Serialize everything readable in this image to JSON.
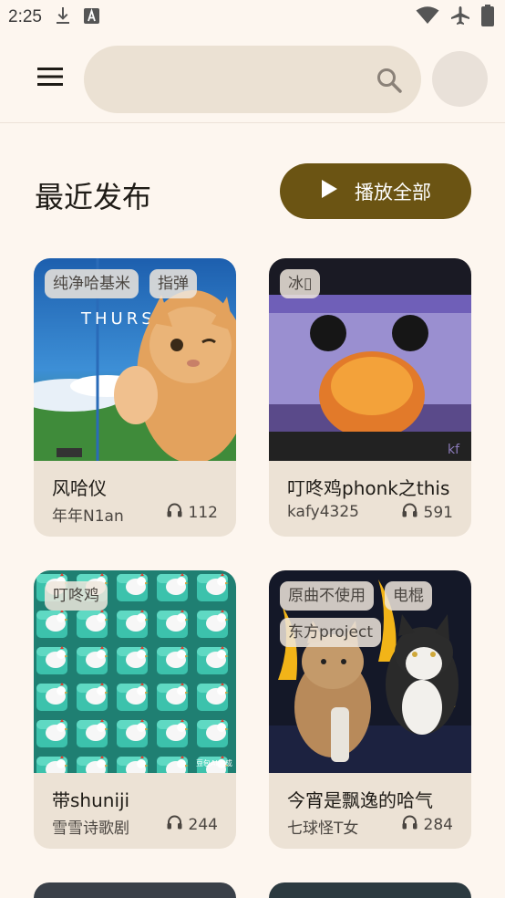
{
  "status_bar": {
    "time": "2:25",
    "left_icons": [
      "download-icon",
      "text-a-icon"
    ],
    "right_icons": [
      "wifi-icon",
      "airplane-icon",
      "battery-icon"
    ]
  },
  "app_bar": {
    "menu_icon": "menu-icon",
    "search": {
      "value": "",
      "placeholder": ""
    },
    "search_icon": "search-icon"
  },
  "section": {
    "title": "最近发布",
    "play_all_label": "播放全部",
    "accent_color": "#6b5413"
  },
  "cards": [
    {
      "title": "风哈仪",
      "author": "年年N1an",
      "plays": "112",
      "tags": [
        "纯净哈基米",
        "指弹"
      ]
    },
    {
      "title": "叮咚鸡phonk之this",
      "author": "kafy4325",
      "plays": "591",
      "tags": [
        "冰▯"
      ]
    },
    {
      "title": "带shuniji",
      "author": "雪雪诗歌剧",
      "plays": "244",
      "tags": [
        "叮咚鸡"
      ]
    },
    {
      "title": "今宵是飘逸的哈气",
      "author": "七球怪T女",
      "plays": "284",
      "tags": [
        "原曲不使用",
        "电棍",
        "东方project"
      ]
    }
  ]
}
